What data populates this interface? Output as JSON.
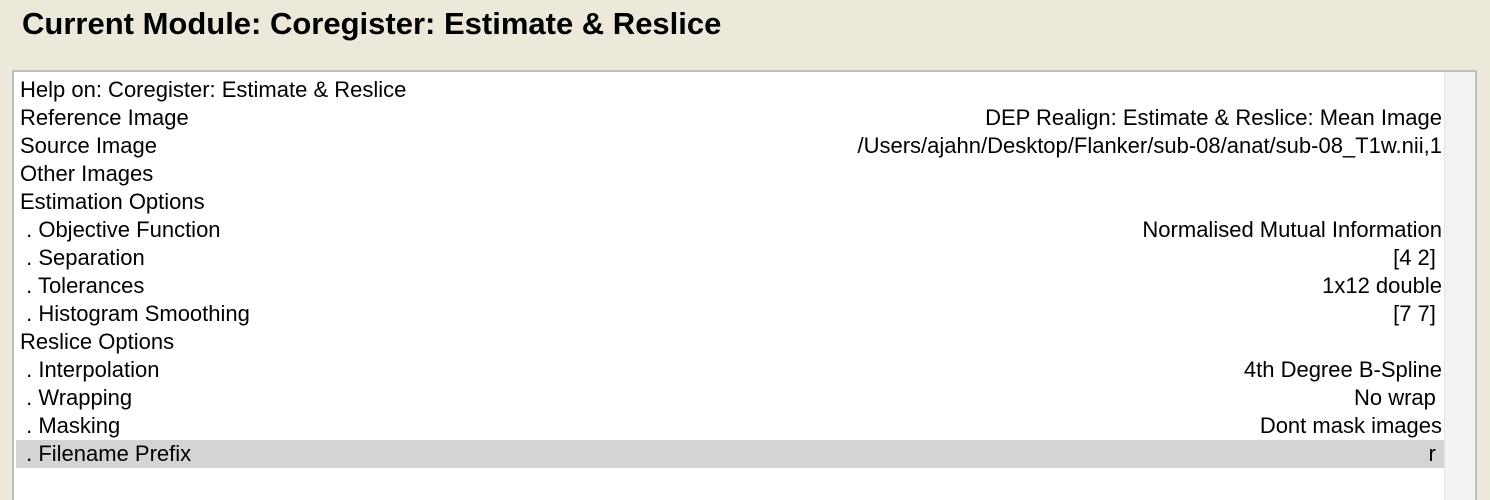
{
  "title": "Current Module: Coregister: Estimate & Reslice",
  "rows": [
    {
      "label": "Help on: Coregister: Estimate & Reslice",
      "value": ""
    },
    {
      "label": "Reference Image",
      "value": "DEP Realign: Estimate & Reslice: Mean Image"
    },
    {
      "label": "Source Image",
      "value": "/Users/ajahn/Desktop/Flanker/sub-08/anat/sub-08_T1w.nii,1"
    },
    {
      "label": "Other Images",
      "value": ""
    },
    {
      "label": "Estimation Options",
      "value": ""
    },
    {
      "label": " . Objective Function",
      "value": "Normalised Mutual Information"
    },
    {
      "label": " . Separation",
      "value": "[4 2] "
    },
    {
      "label": " . Tolerances",
      "value": "1x12 double"
    },
    {
      "label": " . Histogram Smoothing",
      "value": "[7 7] "
    },
    {
      "label": "Reslice Options",
      "value": ""
    },
    {
      "label": " . Interpolation",
      "value": "4th Degree B-Spline"
    },
    {
      "label": " . Wrapping",
      "value": "No wrap "
    },
    {
      "label": " . Masking",
      "value": "Dont mask images"
    },
    {
      "label": " . Filename Prefix",
      "value": "r ",
      "selected": true
    }
  ]
}
